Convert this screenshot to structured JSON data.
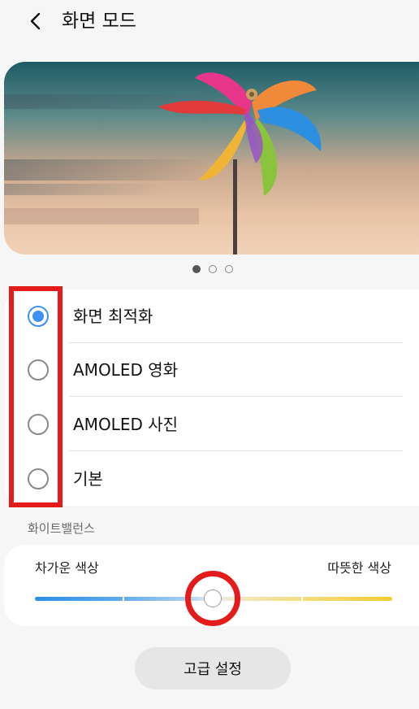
{
  "header": {
    "title": "화면 모드",
    "back_icon": "chevron-left-icon"
  },
  "preview": {
    "page_count": 3,
    "active_page": 1
  },
  "modes": {
    "selected_index": 0,
    "items": [
      {
        "label": "화면 최적화",
        "checked": true
      },
      {
        "label": "AMOLED 영화",
        "checked": false
      },
      {
        "label": "AMOLED 사진",
        "checked": false
      },
      {
        "label": "기본",
        "checked": false
      }
    ]
  },
  "white_balance": {
    "header": "화이트밸런스",
    "left_label": "차가운 색상",
    "right_label": "따뜻한 색상",
    "level_fraction": 0.5
  },
  "advanced_button": {
    "label": "고급 설정"
  },
  "colors": {
    "accent": "#3e91f0",
    "highlight": "#e41b1b",
    "background": "#f6f6f6",
    "card": "#ffffff"
  }
}
